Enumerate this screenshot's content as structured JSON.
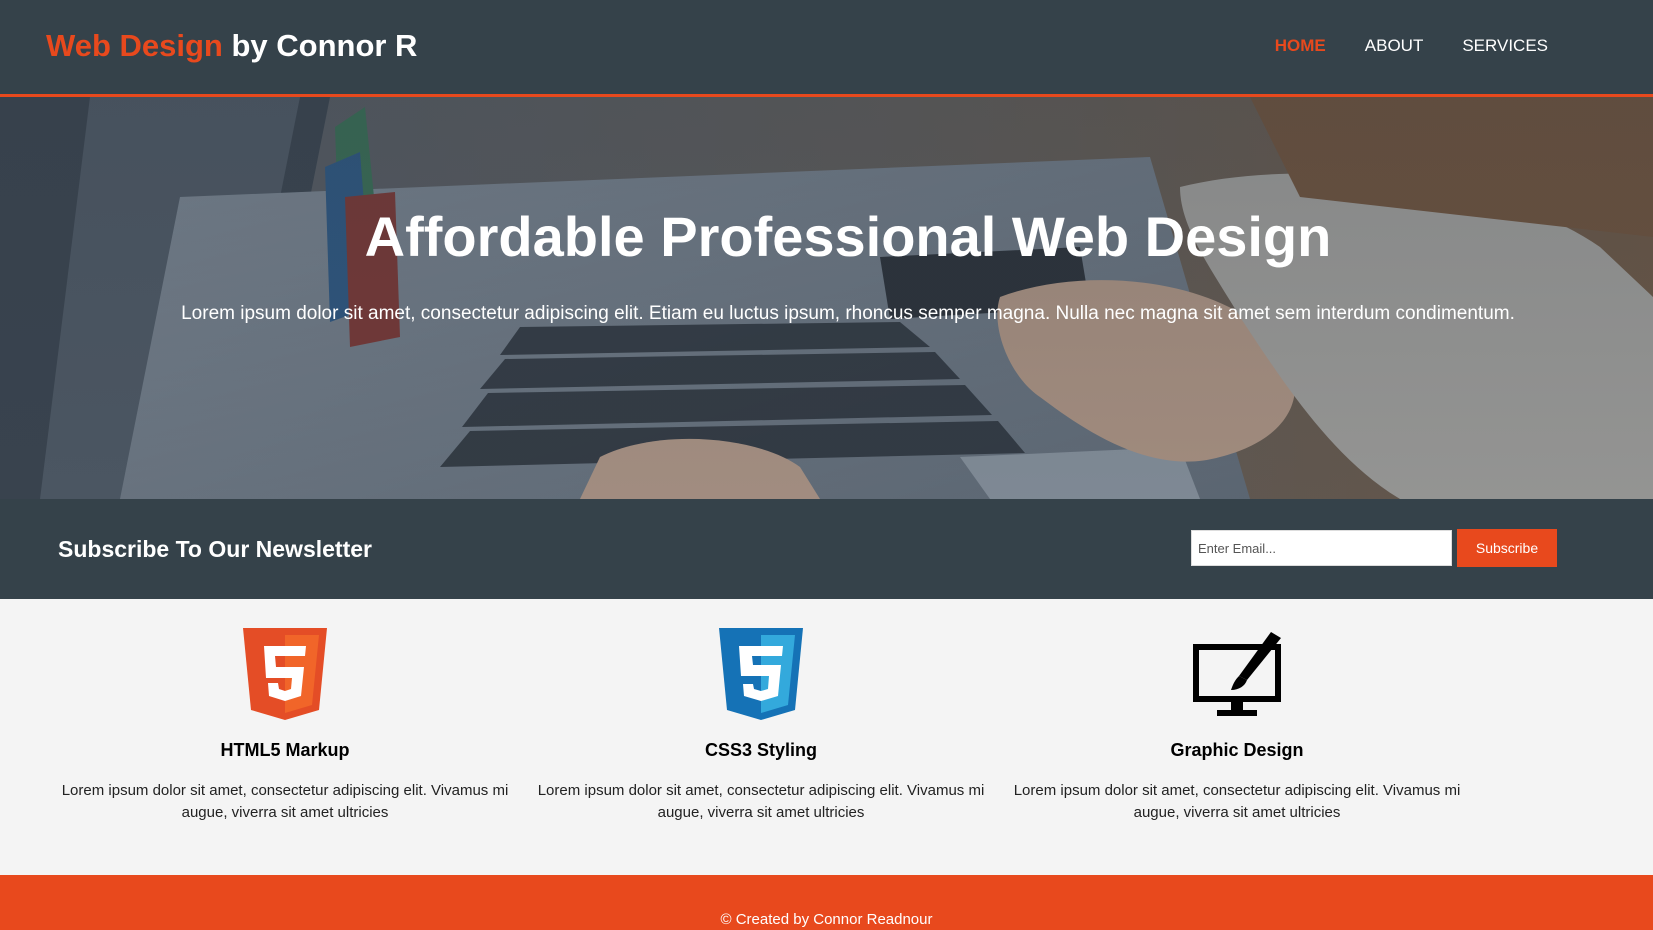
{
  "colors": {
    "accent": "#e8491d",
    "dark": "#35424a",
    "light_bg": "#f4f4f4",
    "white": "#ffffff"
  },
  "header": {
    "brand_highlight": "Web Design",
    "brand_rest": " by Connor R",
    "nav": [
      {
        "label": "HOME",
        "current": true
      },
      {
        "label": "ABOUT",
        "current": false
      },
      {
        "label": "SERVICES",
        "current": false
      }
    ]
  },
  "showcase": {
    "title": "Affordable Professional Web Design",
    "text": "Lorem ipsum dolor sit amet, consectetur adipiscing elit. Etiam eu luctus ipsum, rhoncus semper magna. Nulla nec magna sit amet sem interdum condimentum."
  },
  "newsletter": {
    "heading": "Subscribe To Our Newsletter",
    "email_placeholder": "Enter Email...",
    "email_value": "",
    "button_label": "Subscribe"
  },
  "boxes": [
    {
      "icon": "html5-icon",
      "title": "HTML5 Markup",
      "text": "Lorem ipsum dolor sit amet, consectetur adipiscing elit. Vivamus mi augue, viverra sit amet ultricies"
    },
    {
      "icon": "css3-icon",
      "title": "CSS3 Styling",
      "text": "Lorem ipsum dolor sit amet, consectetur adipiscing elit. Vivamus mi augue, viverra sit amet ultricies"
    },
    {
      "icon": "graphic-design-icon",
      "title": "Graphic Design",
      "text": "Lorem ipsum dolor sit amet, consectetur adipiscing elit. Vivamus mi augue, viverra sit amet ultricies"
    }
  ],
  "footer": {
    "text": "© Created by Connor Readnour"
  }
}
